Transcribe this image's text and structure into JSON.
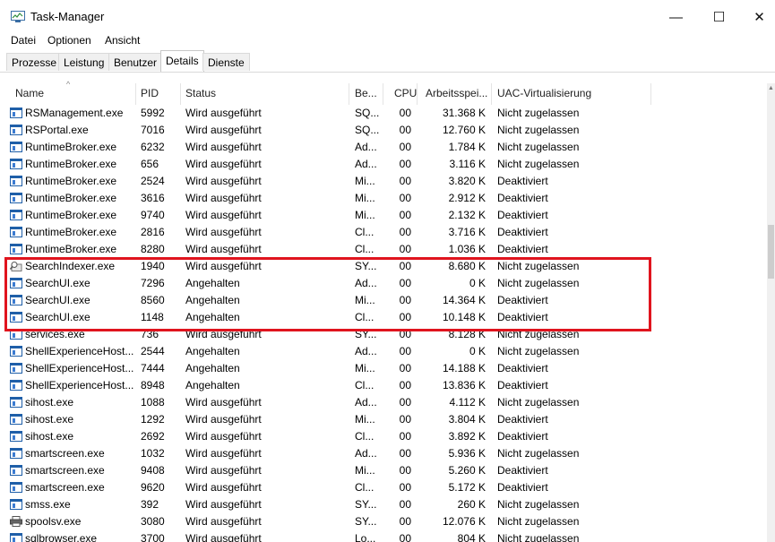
{
  "window": {
    "title": "Task-Manager",
    "minimize": "—",
    "maximize": "☐",
    "close": "✕"
  },
  "menu": [
    "Datei",
    "Optionen",
    "Ansicht"
  ],
  "tabs": [
    {
      "label": "Prozesse",
      "active": false
    },
    {
      "label": "Leistung",
      "active": false
    },
    {
      "label": "Benutzer",
      "active": false
    },
    {
      "label": "Details",
      "active": true
    },
    {
      "label": "Dienste",
      "active": false
    }
  ],
  "columns": {
    "name": "Name",
    "pid": "PID",
    "status": "Status",
    "user": "Be...",
    "cpu": "CPU",
    "memory": "Arbeitsspei...",
    "uac": "UAC-Virtualisierung"
  },
  "rows": [
    {
      "name": "RSManagement.exe",
      "pid": "5992",
      "status": "Wird ausgeführt",
      "user": "SQ...",
      "cpu": "00",
      "memory": "31.368 K",
      "uac": "Nicht zugelassen",
      "icon": "process-icon"
    },
    {
      "name": "RSPortal.exe",
      "pid": "7016",
      "status": "Wird ausgeführt",
      "user": "SQ...",
      "cpu": "00",
      "memory": "12.760 K",
      "uac": "Nicht zugelassen",
      "icon": "process-icon"
    },
    {
      "name": "RuntimeBroker.exe",
      "pid": "6232",
      "status": "Wird ausgeführt",
      "user": "Ad...",
      "cpu": "00",
      "memory": "1.784 K",
      "uac": "Nicht zugelassen",
      "icon": "process-icon"
    },
    {
      "name": "RuntimeBroker.exe",
      "pid": "656",
      "status": "Wird ausgeführt",
      "user": "Ad...",
      "cpu": "00",
      "memory": "3.116 K",
      "uac": "Nicht zugelassen",
      "icon": "process-icon"
    },
    {
      "name": "RuntimeBroker.exe",
      "pid": "2524",
      "status": "Wird ausgeführt",
      "user": "Mi...",
      "cpu": "00",
      "memory": "3.820 K",
      "uac": "Deaktiviert",
      "icon": "process-icon"
    },
    {
      "name": "RuntimeBroker.exe",
      "pid": "3616",
      "status": "Wird ausgeführt",
      "user": "Mi...",
      "cpu": "00",
      "memory": "2.912 K",
      "uac": "Deaktiviert",
      "icon": "process-icon"
    },
    {
      "name": "RuntimeBroker.exe",
      "pid": "9740",
      "status": "Wird ausgeführt",
      "user": "Mi...",
      "cpu": "00",
      "memory": "2.132 K",
      "uac": "Deaktiviert",
      "icon": "process-icon"
    },
    {
      "name": "RuntimeBroker.exe",
      "pid": "2816",
      "status": "Wird ausgeführt",
      "user": "Cl...",
      "cpu": "00",
      "memory": "3.716 K",
      "uac": "Deaktiviert",
      "icon": "process-icon"
    },
    {
      "name": "RuntimeBroker.exe",
      "pid": "8280",
      "status": "Wird ausgeführt",
      "user": "Cl...",
      "cpu": "00",
      "memory": "1.036 K",
      "uac": "Deaktiviert",
      "icon": "process-icon"
    },
    {
      "name": "SearchIndexer.exe",
      "pid": "1940",
      "status": "Wird ausgeführt",
      "user": "SY...",
      "cpu": "00",
      "memory": "8.680 K",
      "uac": "Nicht zugelassen",
      "icon": "search-indexer-icon"
    },
    {
      "name": "SearchUI.exe",
      "pid": "7296",
      "status": "Angehalten",
      "user": "Ad...",
      "cpu": "00",
      "memory": "0 K",
      "uac": "Nicht zugelassen",
      "icon": "process-icon"
    },
    {
      "name": "SearchUI.exe",
      "pid": "8560",
      "status": "Angehalten",
      "user": "Mi...",
      "cpu": "00",
      "memory": "14.364 K",
      "uac": "Deaktiviert",
      "icon": "process-icon"
    },
    {
      "name": "SearchUI.exe",
      "pid": "1148",
      "status": "Angehalten",
      "user": "Cl...",
      "cpu": "00",
      "memory": "10.148 K",
      "uac": "Deaktiviert",
      "icon": "process-icon"
    },
    {
      "name": "services.exe",
      "pid": "736",
      "status": "Wird ausgeführt",
      "user": "SY...",
      "cpu": "00",
      "memory": "8.128 K",
      "uac": "Nicht zugelassen",
      "icon": "process-icon"
    },
    {
      "name": "ShellExperienceHost...",
      "pid": "2544",
      "status": "Angehalten",
      "user": "Ad...",
      "cpu": "00",
      "memory": "0 K",
      "uac": "Nicht zugelassen",
      "icon": "process-icon"
    },
    {
      "name": "ShellExperienceHost...",
      "pid": "7444",
      "status": "Angehalten",
      "user": "Mi...",
      "cpu": "00",
      "memory": "14.188 K",
      "uac": "Deaktiviert",
      "icon": "process-icon"
    },
    {
      "name": "ShellExperienceHost...",
      "pid": "8948",
      "status": "Angehalten",
      "user": "Cl...",
      "cpu": "00",
      "memory": "13.836 K",
      "uac": "Deaktiviert",
      "icon": "process-icon"
    },
    {
      "name": "sihost.exe",
      "pid": "1088",
      "status": "Wird ausgeführt",
      "user": "Ad...",
      "cpu": "00",
      "memory": "4.112 K",
      "uac": "Nicht zugelassen",
      "icon": "process-icon"
    },
    {
      "name": "sihost.exe",
      "pid": "1292",
      "status": "Wird ausgeführt",
      "user": "Mi...",
      "cpu": "00",
      "memory": "3.804 K",
      "uac": "Deaktiviert",
      "icon": "process-icon"
    },
    {
      "name": "sihost.exe",
      "pid": "2692",
      "status": "Wird ausgeführt",
      "user": "Cl...",
      "cpu": "00",
      "memory": "3.892 K",
      "uac": "Deaktiviert",
      "icon": "process-icon"
    },
    {
      "name": "smartscreen.exe",
      "pid": "1032",
      "status": "Wird ausgeführt",
      "user": "Ad...",
      "cpu": "00",
      "memory": "5.936 K",
      "uac": "Nicht zugelassen",
      "icon": "process-icon"
    },
    {
      "name": "smartscreen.exe",
      "pid": "9408",
      "status": "Wird ausgeführt",
      "user": "Mi...",
      "cpu": "00",
      "memory": "5.260 K",
      "uac": "Deaktiviert",
      "icon": "process-icon"
    },
    {
      "name": "smartscreen.exe",
      "pid": "9620",
      "status": "Wird ausgeführt",
      "user": "Cl...",
      "cpu": "00",
      "memory": "5.172 K",
      "uac": "Deaktiviert",
      "icon": "process-icon"
    },
    {
      "name": "smss.exe",
      "pid": "392",
      "status": "Wird ausgeführt",
      "user": "SY...",
      "cpu": "00",
      "memory": "260 K",
      "uac": "Nicht zugelassen",
      "icon": "process-icon"
    },
    {
      "name": "spoolsv.exe",
      "pid": "3080",
      "status": "Wird ausgeführt",
      "user": "SY...",
      "cpu": "00",
      "memory": "12.076 K",
      "uac": "Nicht zugelassen",
      "icon": "printer-icon"
    },
    {
      "name": "sqlbrowser.exe",
      "pid": "3700",
      "status": "Wird ausgeführt",
      "user": "Lo...",
      "cpu": "00",
      "memory": "804 K",
      "uac": "Nicht zugelassen",
      "icon": "process-icon"
    }
  ],
  "highlight_color": "#e0141e"
}
